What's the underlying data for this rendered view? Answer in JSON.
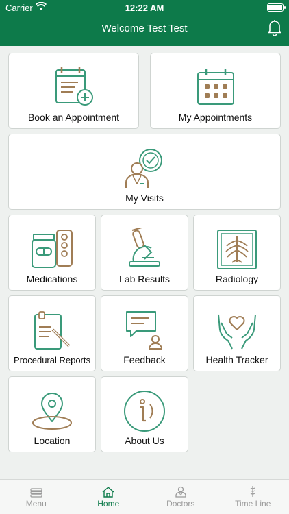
{
  "status_bar": {
    "carrier": "Carrier",
    "time": "12:22 AM"
  },
  "header": {
    "title": "Welcome Test Test"
  },
  "tiles": [
    {
      "label": "Book an Appointment",
      "icon": "book-appointment-icon"
    },
    {
      "label": "My Appointments",
      "icon": "calendar-icon"
    },
    {
      "label": "My Visits",
      "icon": "doctor-visit-icon"
    },
    {
      "label": "Medications",
      "icon": "medications-icon"
    },
    {
      "label": "Lab Results",
      "icon": "microscope-icon"
    },
    {
      "label": "Radiology",
      "icon": "xray-icon"
    },
    {
      "label": "Procedural Reports",
      "icon": "procedural-reports-icon"
    },
    {
      "label": "Feedback",
      "icon": "feedback-icon"
    },
    {
      "label": "Health Tracker",
      "icon": "health-tracker-icon"
    },
    {
      "label": "Location",
      "icon": "location-pin-icon"
    },
    {
      "label": "About Us",
      "icon": "info-icon"
    }
  ],
  "tabs": [
    {
      "label": "Menu",
      "icon": "menu-icon"
    },
    {
      "label": "Home",
      "icon": "home-icon",
      "active": true
    },
    {
      "label": "Doctors",
      "icon": "doctors-icon"
    },
    {
      "label": "Time Line",
      "icon": "timeline-icon"
    }
  ],
  "colors": {
    "brand": "#0d7a4a",
    "icon_green": "#3a9a7a",
    "icon_brown": "#a07d55"
  }
}
